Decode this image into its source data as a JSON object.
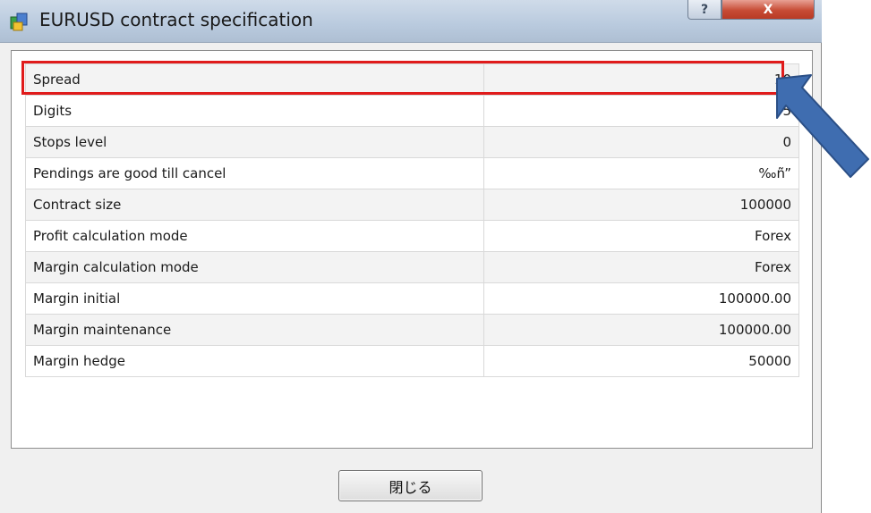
{
  "window": {
    "title": "EURUSD contract specification",
    "help_label": "?",
    "close_label": "X"
  },
  "specs": [
    {
      "name": "Spread",
      "value": "10"
    },
    {
      "name": "Digits",
      "value": "5"
    },
    {
      "name": "Stops level",
      "value": "0"
    },
    {
      "name": "Pendings are good till cancel",
      "value": "‰ñ”"
    },
    {
      "name": "Contract size",
      "value": "100000"
    },
    {
      "name": "Profit calculation mode",
      "value": "Forex"
    },
    {
      "name": "Margin calculation mode",
      "value": "Forex"
    },
    {
      "name": "Margin initial",
      "value": "100000.00"
    },
    {
      "name": "Margin maintenance",
      "value": "100000.00"
    },
    {
      "name": "Margin hedge",
      "value": "50000"
    }
  ],
  "footer": {
    "close_button_label": "閉じる"
  },
  "colors": {
    "highlight": "#e01b1b",
    "arrow": "#3f6db0"
  }
}
